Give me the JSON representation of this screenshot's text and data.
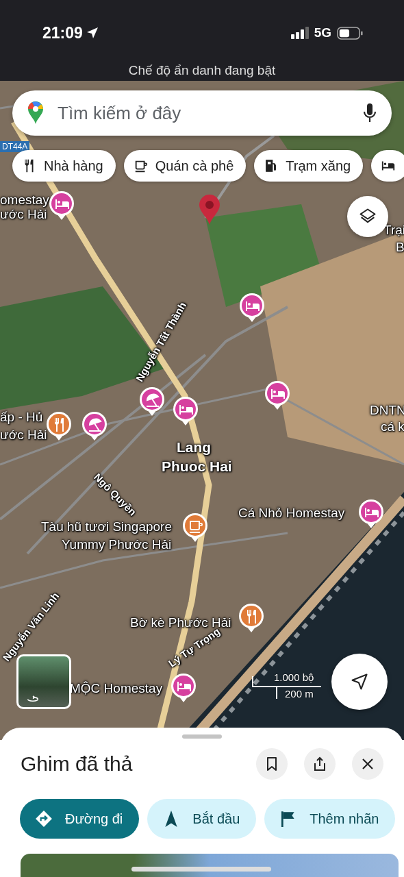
{
  "status_bar": {
    "time": "21:09",
    "network": "5G"
  },
  "incognito_banner": "Chế độ ẩn danh đang bật",
  "search": {
    "placeholder": "Tìm kiếm ở đây"
  },
  "chips": [
    {
      "kind": "restaurant",
      "label": "Nhà hàng"
    },
    {
      "kind": "cafe",
      "label": "Quán cà phê"
    },
    {
      "kind": "gas",
      "label": "Trạm xăng"
    },
    {
      "kind": "hotel"
    }
  ],
  "map": {
    "road_shield": "DT44A",
    "labels": [
      {
        "kind": "place",
        "text": "omestay"
      },
      {
        "kind": "place",
        "text": "ước Hải"
      },
      {
        "kind": "place",
        "text": "Trại"
      },
      {
        "kind": "place",
        "text": "B"
      },
      {
        "kind": "road",
        "text": "Nguyễn Tất Thành"
      },
      {
        "kind": "place",
        "text": "ấp - Hủ"
      },
      {
        "kind": "place",
        "text": "ước Hải"
      },
      {
        "kind": "place",
        "text": "DNTN"
      },
      {
        "kind": "place",
        "text": "cá k"
      },
      {
        "kind": "area",
        "text": "Lang"
      },
      {
        "kind": "area",
        "text": "Phuoc Hai"
      },
      {
        "kind": "road",
        "text": "Ngô Quyền"
      },
      {
        "kind": "place",
        "text": "Tàu hũ tươi Singapore"
      },
      {
        "kind": "place",
        "text": "Yummy Phước Hải"
      },
      {
        "kind": "place",
        "text": "Cá Nhỏ Homestay"
      },
      {
        "kind": "road",
        "text": "Nguyễn Văn Linh"
      },
      {
        "kind": "place",
        "text": "Bờ kè Phước Hải"
      },
      {
        "kind": "road",
        "text": "Lý Tự Trọng"
      },
      {
        "kind": "place",
        "text": "MỘC Homestay"
      }
    ],
    "pins": [
      {
        "kind": "hotel",
        "color": "#d6409f"
      },
      {
        "kind": "hotel",
        "color": "#d6409f"
      },
      {
        "kind": "beach",
        "color": "#d6409f"
      },
      {
        "kind": "hotel",
        "color": "#d6409f"
      },
      {
        "kind": "hotel",
        "color": "#d6409f"
      },
      {
        "kind": "restaurant",
        "color": "#e07b39"
      },
      {
        "kind": "beach",
        "color": "#d6409f"
      },
      {
        "kind": "cafe",
        "color": "#e07b39"
      },
      {
        "kind": "hotel",
        "color": "#d6409f"
      },
      {
        "kind": "restaurant",
        "color": "#e07b39"
      },
      {
        "kind": "hotel",
        "color": "#d6409f"
      }
    ],
    "scale": {
      "imperial": "1.000 bộ",
      "metric": "200 m"
    }
  },
  "sheet": {
    "title": "Ghim đã thả",
    "actions": [
      {
        "kind": "directions",
        "label": "Đường đi",
        "primary": true
      },
      {
        "kind": "start",
        "label": "Bắt đầu",
        "primary": false
      },
      {
        "kind": "label",
        "label": "Thêm nhãn",
        "primary": false
      }
    ]
  }
}
